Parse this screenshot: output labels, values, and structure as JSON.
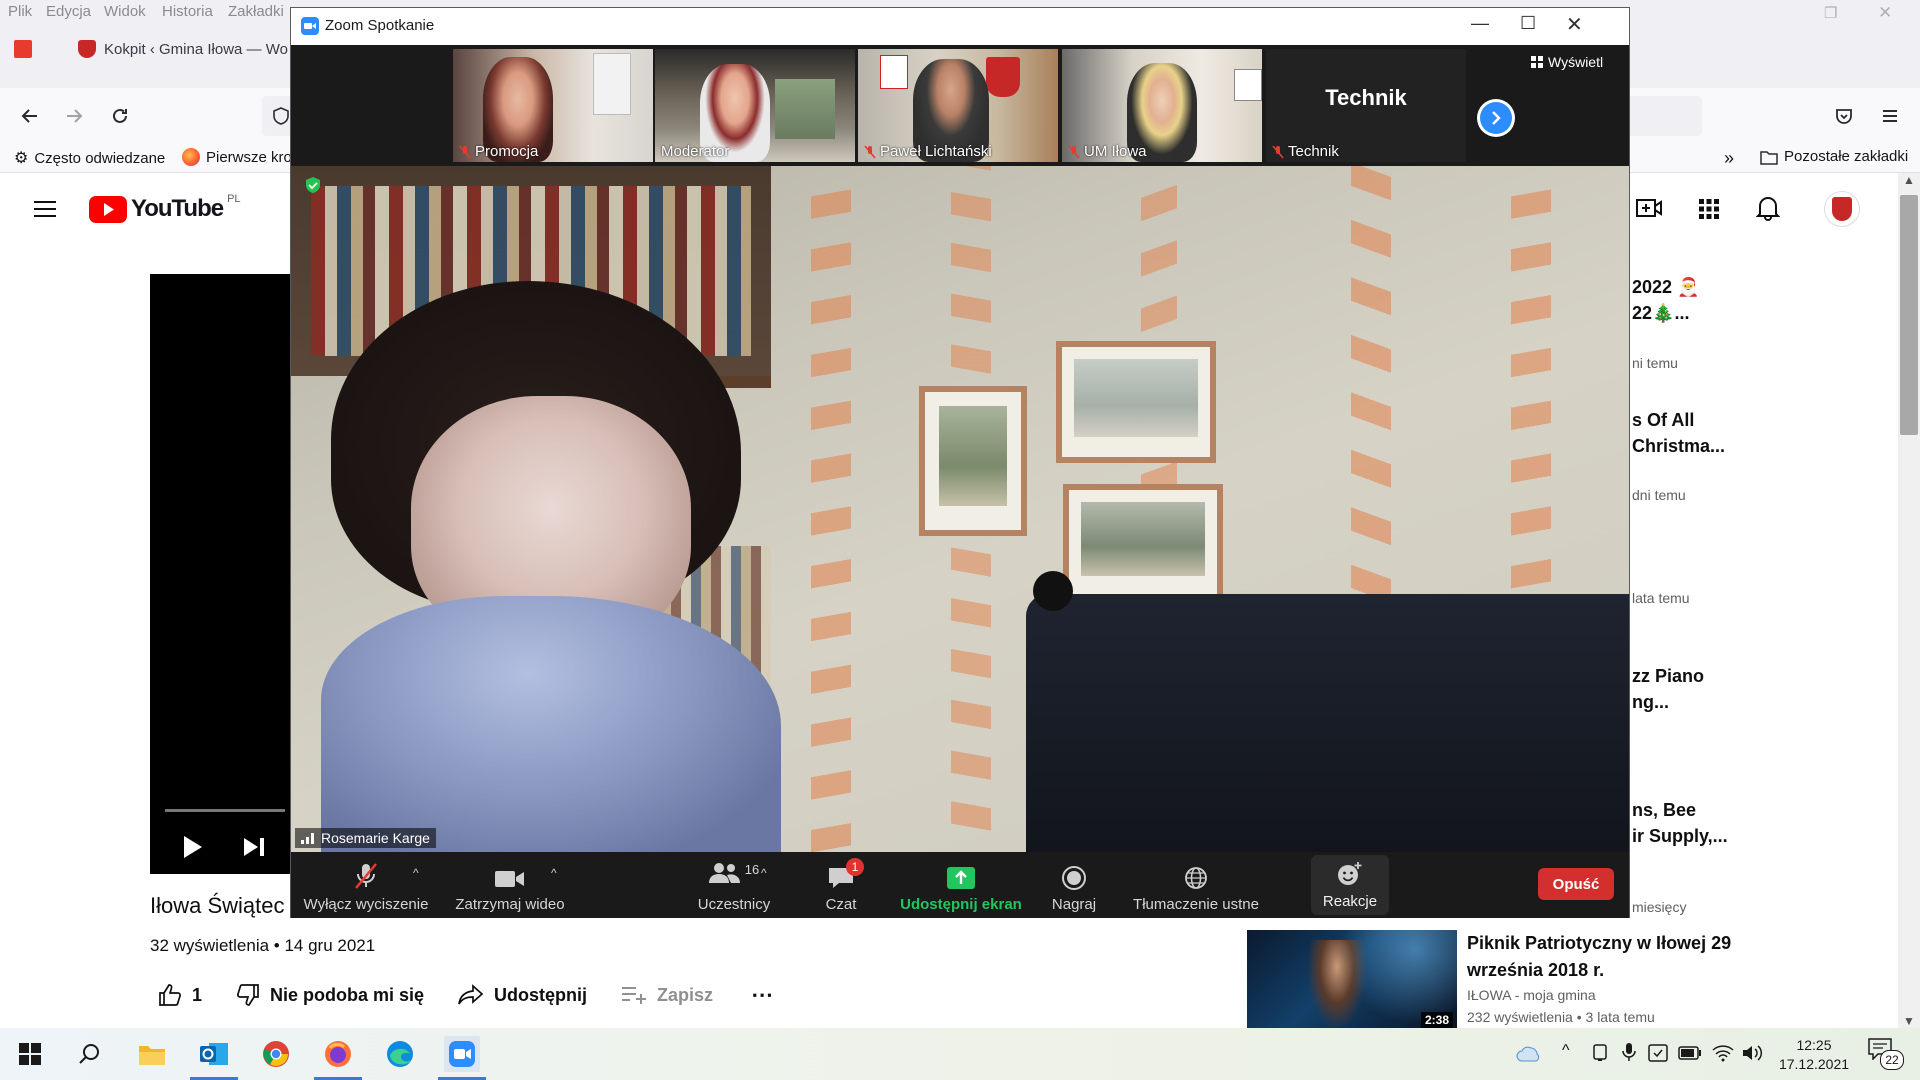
{
  "firefox": {
    "menu": [
      "Plik",
      "Edycja",
      "Widok",
      "Historia",
      "Zakładki"
    ],
    "tab_label": "Kokpit ‹ Gmina Iłowa — Wo",
    "bookmarks": {
      "often_visited": "Często odwiedzane",
      "first_steps": "Pierwsze kro",
      "others": "Pozostałe zakładki"
    }
  },
  "youtube": {
    "logo": "YouTube",
    "region": "PL",
    "video_title": "Iłowa Świątec",
    "views_line": "32 wyświetlenia",
    "date": " • 14 gru 2021",
    "actions": {
      "like_count": "1",
      "dislike_label": "Nie podoba mi się",
      "share_label": "Udostępnij",
      "save_label": "Zapisz"
    },
    "sidebar": [
      {
        "title1": "2022",
        "title2": "22",
        "meta": "ni temu"
      },
      {
        "title1": "s Of All",
        "title2": "Christma...",
        "meta": "dni temu"
      },
      {
        "title1": "",
        "title2": "",
        "meta": "lata temu"
      },
      {
        "title1": "zz Piano",
        "title2": "ng...",
        "meta": ""
      },
      {
        "title1": "ns, Bee",
        "title2": "ir Supply,...",
        "meta": "miesięcy"
      }
    ],
    "recommended": {
      "title_line1": "Piknik Patriotyczny w Iłowej 29",
      "title_line2": "września 2018 r.",
      "channel": "IŁOWA - moja gmina",
      "meta": "232 wyświetlenia • 3 lata temu",
      "duration": "2:38"
    }
  },
  "zoom": {
    "window_title": "Zoom Spotkanie",
    "view_button": "Wyświetl",
    "participants": [
      {
        "name": "Promocja",
        "muted": true
      },
      {
        "name": "Moderator",
        "muted": false
      },
      {
        "name": "Paweł Lichtański",
        "muted": true
      },
      {
        "name": "UM Iłowa",
        "muted": true
      },
      {
        "name": "Technik",
        "muted": true,
        "big_label": "Technik"
      }
    ],
    "main_speaker": "Rosemarie Karge",
    "toolbar": {
      "unmute": "Wyłącz wyciszenie",
      "stop_video": "Zatrzymaj wideo",
      "participants": "Uczestnicy",
      "participants_count": "16",
      "chat": "Czat",
      "chat_badge": "1",
      "share": "Udostępnij ekran",
      "record": "Nagraj",
      "interpretation": "Tłumaczenie ustne",
      "reactions": "Reakcje",
      "leave": "Opuść"
    },
    "colors": {
      "share_green": "#22c55e",
      "leave_red": "#d32f2f",
      "badge_red": "#e0322f"
    }
  },
  "taskbar": {
    "time": "12:25",
    "date": "17.12.2021",
    "notif_count": "22"
  }
}
